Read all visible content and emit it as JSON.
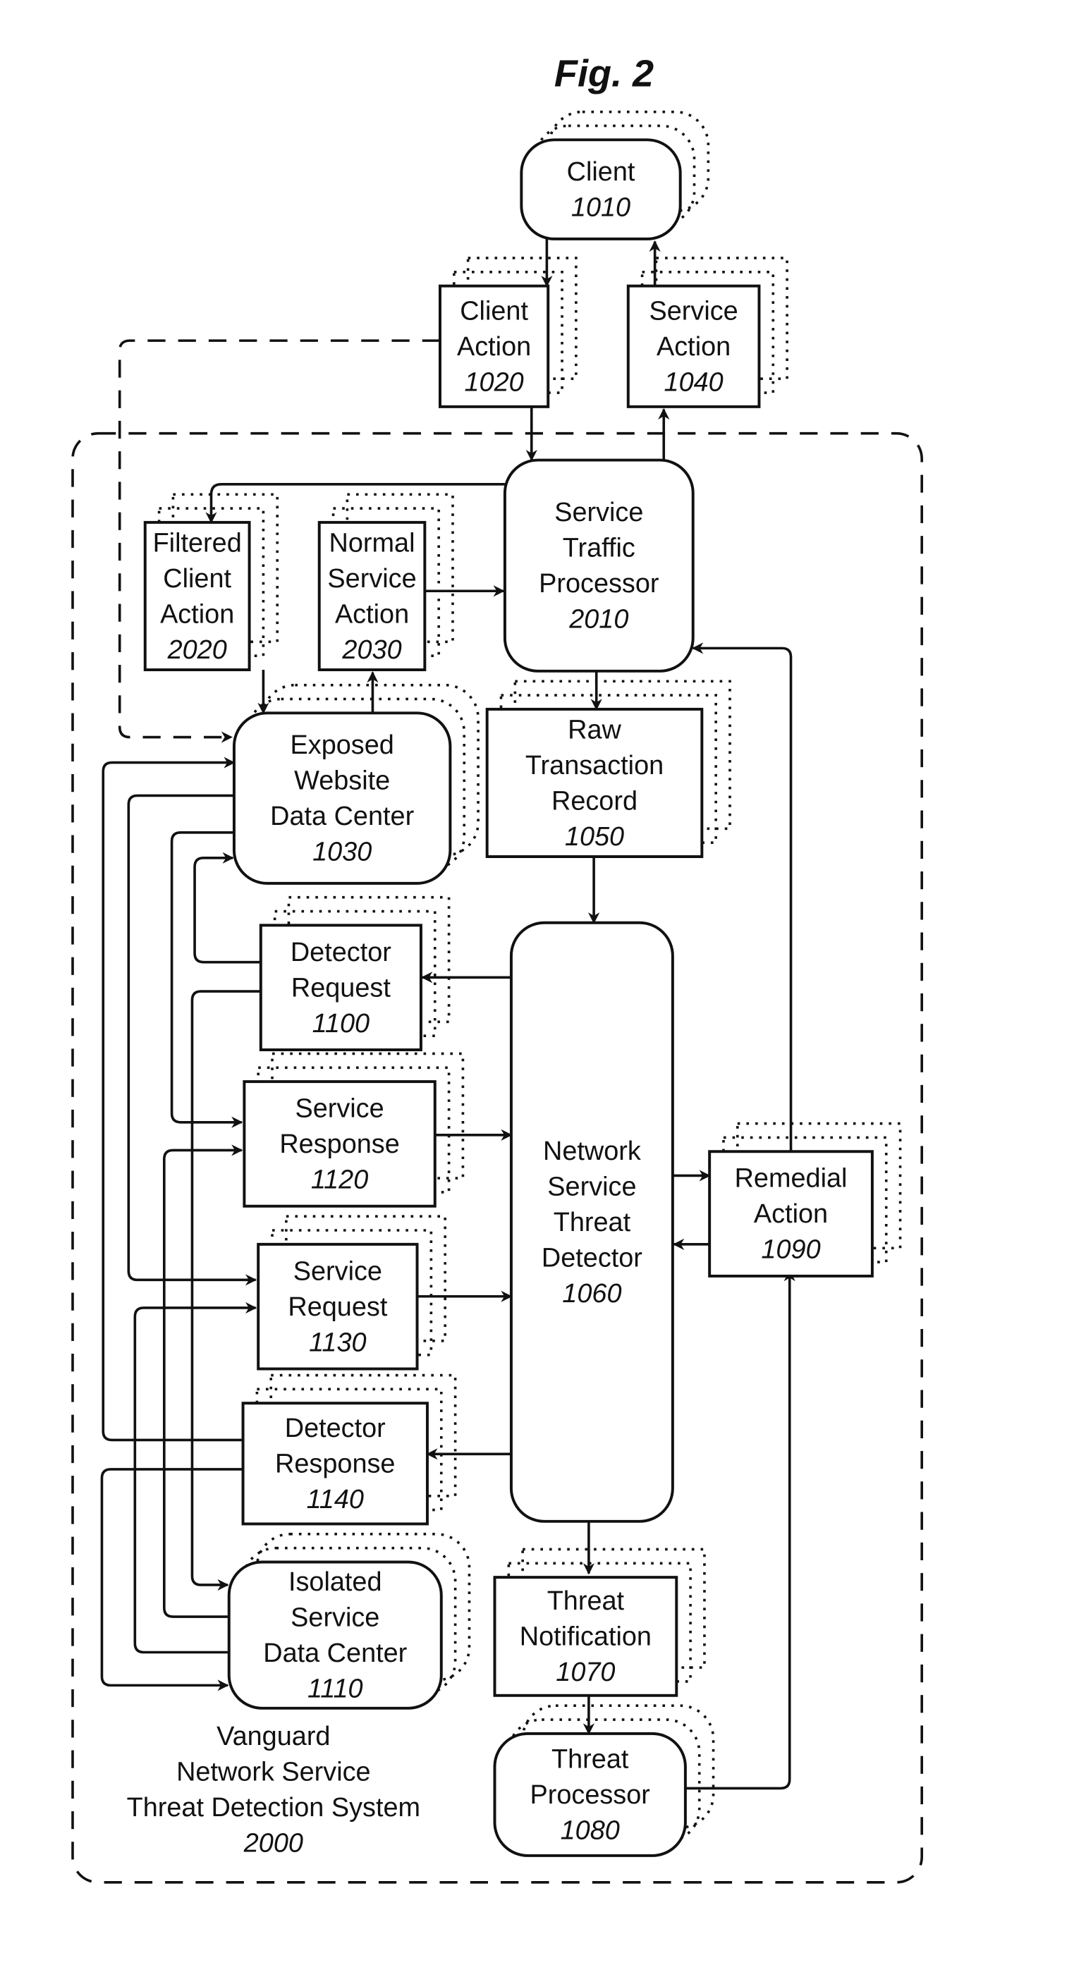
{
  "figure": {
    "title": "Fig. 2",
    "system": {
      "lines": [
        "Vanguard",
        "Network Service",
        "Threat Detection System"
      ],
      "number": "2000"
    }
  },
  "nodes": {
    "client": {
      "lines": [
        "Client"
      ],
      "number": "1010",
      "shape": "rounded"
    },
    "client_action": {
      "lines": [
        "Client",
        "Action"
      ],
      "number": "1020",
      "shape": "rect"
    },
    "service_action": {
      "lines": [
        "Service",
        "Action"
      ],
      "number": "1040",
      "shape": "rect"
    },
    "service_traffic_processor": {
      "lines": [
        "Service",
        "Traffic",
        "Processor"
      ],
      "number": "2010",
      "shape": "rounded"
    },
    "filtered_client_action": {
      "lines": [
        "Filtered",
        "Client",
        "Action"
      ],
      "number": "2020",
      "shape": "rect"
    },
    "normal_service_action": {
      "lines": [
        "Normal",
        "Service",
        "Action"
      ],
      "number": "2030",
      "shape": "rect"
    },
    "exposed_website_data_center": {
      "lines": [
        "Exposed",
        "Website",
        "Data Center"
      ],
      "number": "1030",
      "shape": "rounded"
    },
    "raw_transaction_record": {
      "lines": [
        "Raw",
        "Transaction",
        "Record"
      ],
      "number": "1050",
      "shape": "rect"
    },
    "detector_request": {
      "lines": [
        "Detector",
        "Request"
      ],
      "number": "1100",
      "shape": "rect"
    },
    "service_response": {
      "lines": [
        "Service",
        "Response"
      ],
      "number": "1120",
      "shape": "rect"
    },
    "service_request": {
      "lines": [
        "Service",
        "Request"
      ],
      "number": "1130",
      "shape": "rect"
    },
    "detector_response": {
      "lines": [
        "Detector",
        "Response"
      ],
      "number": "1140",
      "shape": "rect"
    },
    "network_service_threat_detector": {
      "lines": [
        "Network",
        "Service",
        "Threat",
        "Detector"
      ],
      "number": "1060",
      "shape": "rounded"
    },
    "remedial_action": {
      "lines": [
        "Remedial",
        "Action"
      ],
      "number": "1090",
      "shape": "rect"
    },
    "isolated_service_data_center": {
      "lines": [
        "Isolated",
        "Service",
        "Data Center"
      ],
      "number": "1110",
      "shape": "rounded"
    },
    "threat_notification": {
      "lines": [
        "Threat",
        "Notification"
      ],
      "number": "1070",
      "shape": "rect"
    },
    "threat_processor": {
      "lines": [
        "Threat",
        "Processor"
      ],
      "number": "1080",
      "shape": "rounded"
    }
  },
  "edges": [
    {
      "from": "client",
      "to": "client_action"
    },
    {
      "from": "service_action",
      "to": "client"
    },
    {
      "from": "client_action",
      "to": "service_traffic_processor"
    },
    {
      "from": "service_traffic_processor",
      "to": "service_action"
    },
    {
      "from": "service_traffic_processor",
      "to": "filtered_client_action"
    },
    {
      "from": "normal_service_action",
      "to": "service_traffic_processor"
    },
    {
      "from": "filtered_client_action",
      "to": "exposed_website_data_center"
    },
    {
      "from": "exposed_website_data_center",
      "to": "normal_service_action"
    },
    {
      "from": "client_action",
      "to": "exposed_website_data_center",
      "style": "dashed"
    },
    {
      "from": "service_traffic_processor",
      "to": "raw_transaction_record"
    },
    {
      "from": "raw_transaction_record",
      "to": "network_service_threat_detector"
    },
    {
      "from": "network_service_threat_detector",
      "to": "detector_request"
    },
    {
      "from": "detector_request",
      "to": "exposed_website_data_center"
    },
    {
      "from": "detector_request",
      "to": "isolated_service_data_center"
    },
    {
      "from": "exposed_website_data_center",
      "to": "service_response"
    },
    {
      "from": "isolated_service_data_center",
      "to": "service_response"
    },
    {
      "from": "service_response",
      "to": "network_service_threat_detector"
    },
    {
      "from": "exposed_website_data_center",
      "to": "service_request"
    },
    {
      "from": "isolated_service_data_center",
      "to": "service_request"
    },
    {
      "from": "service_request",
      "to": "network_service_threat_detector"
    },
    {
      "from": "network_service_threat_detector",
      "to": "detector_response"
    },
    {
      "from": "detector_response",
      "to": "exposed_website_data_center"
    },
    {
      "from": "detector_response",
      "to": "isolated_service_data_center"
    },
    {
      "from": "network_service_threat_detector",
      "to": "remedial_action"
    },
    {
      "from": "remedial_action",
      "to": "network_service_threat_detector"
    },
    {
      "from": "remedial_action",
      "to": "service_traffic_processor"
    },
    {
      "from": "network_service_threat_detector",
      "to": "threat_notification"
    },
    {
      "from": "threat_notification",
      "to": "threat_processor"
    },
    {
      "from": "threat_processor",
      "to": "remedial_action"
    }
  ]
}
